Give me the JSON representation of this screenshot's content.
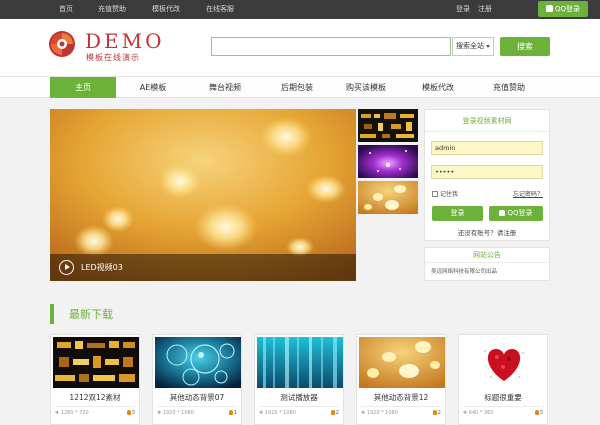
{
  "topbar": {
    "links": [
      "首页",
      "充值赞助",
      "模板代改",
      "在线客服"
    ],
    "login": "登录",
    "register": "注册",
    "qq_login": "QQ登录"
  },
  "header": {
    "logo_text": "DEMO",
    "logo_sub": "模板在线演示",
    "search_value": "",
    "search_select": "搜索全站",
    "search_button": "搜索"
  },
  "nav": {
    "items": [
      "主页",
      "AE模板",
      "舞台视频",
      "后期包装",
      "购买该模板",
      "模板代改",
      "充值赞助"
    ],
    "active_index": 0
  },
  "hero": {
    "title": "LED视频03"
  },
  "login_panel": {
    "title": "登录视频素材网",
    "username": "admin",
    "password_mask": "•••••",
    "remember": "记住我",
    "forgot": "忘记密码？",
    "login_button": "登录",
    "qq_button": "QQ登录",
    "register_prompt": "还没有账号？请注册"
  },
  "notice": {
    "title": "网站公告",
    "text": "吴远网络科技有限公司出品"
  },
  "section": {
    "title": "最新下载"
  },
  "cards": [
    {
      "title": "1212双12素材",
      "res": "✚ 1280 * 720",
      "count": "3"
    },
    {
      "title": "其他动态背景07",
      "res": "✚ 1920 * 1080",
      "count": "1"
    },
    {
      "title": "测试播放器",
      "res": "✚ 1920 * 1080",
      "count": "2"
    },
    {
      "title": "其他动态背景12",
      "res": "✚ 1920 * 1080",
      "count": "2"
    },
    {
      "title": "标题很重要",
      "res": "✚ 640 * 360",
      "count": "3"
    }
  ],
  "colors": {
    "accent": "#6cb13a",
    "topbar": "#3b3b3b",
    "brand": "#c23333"
  }
}
